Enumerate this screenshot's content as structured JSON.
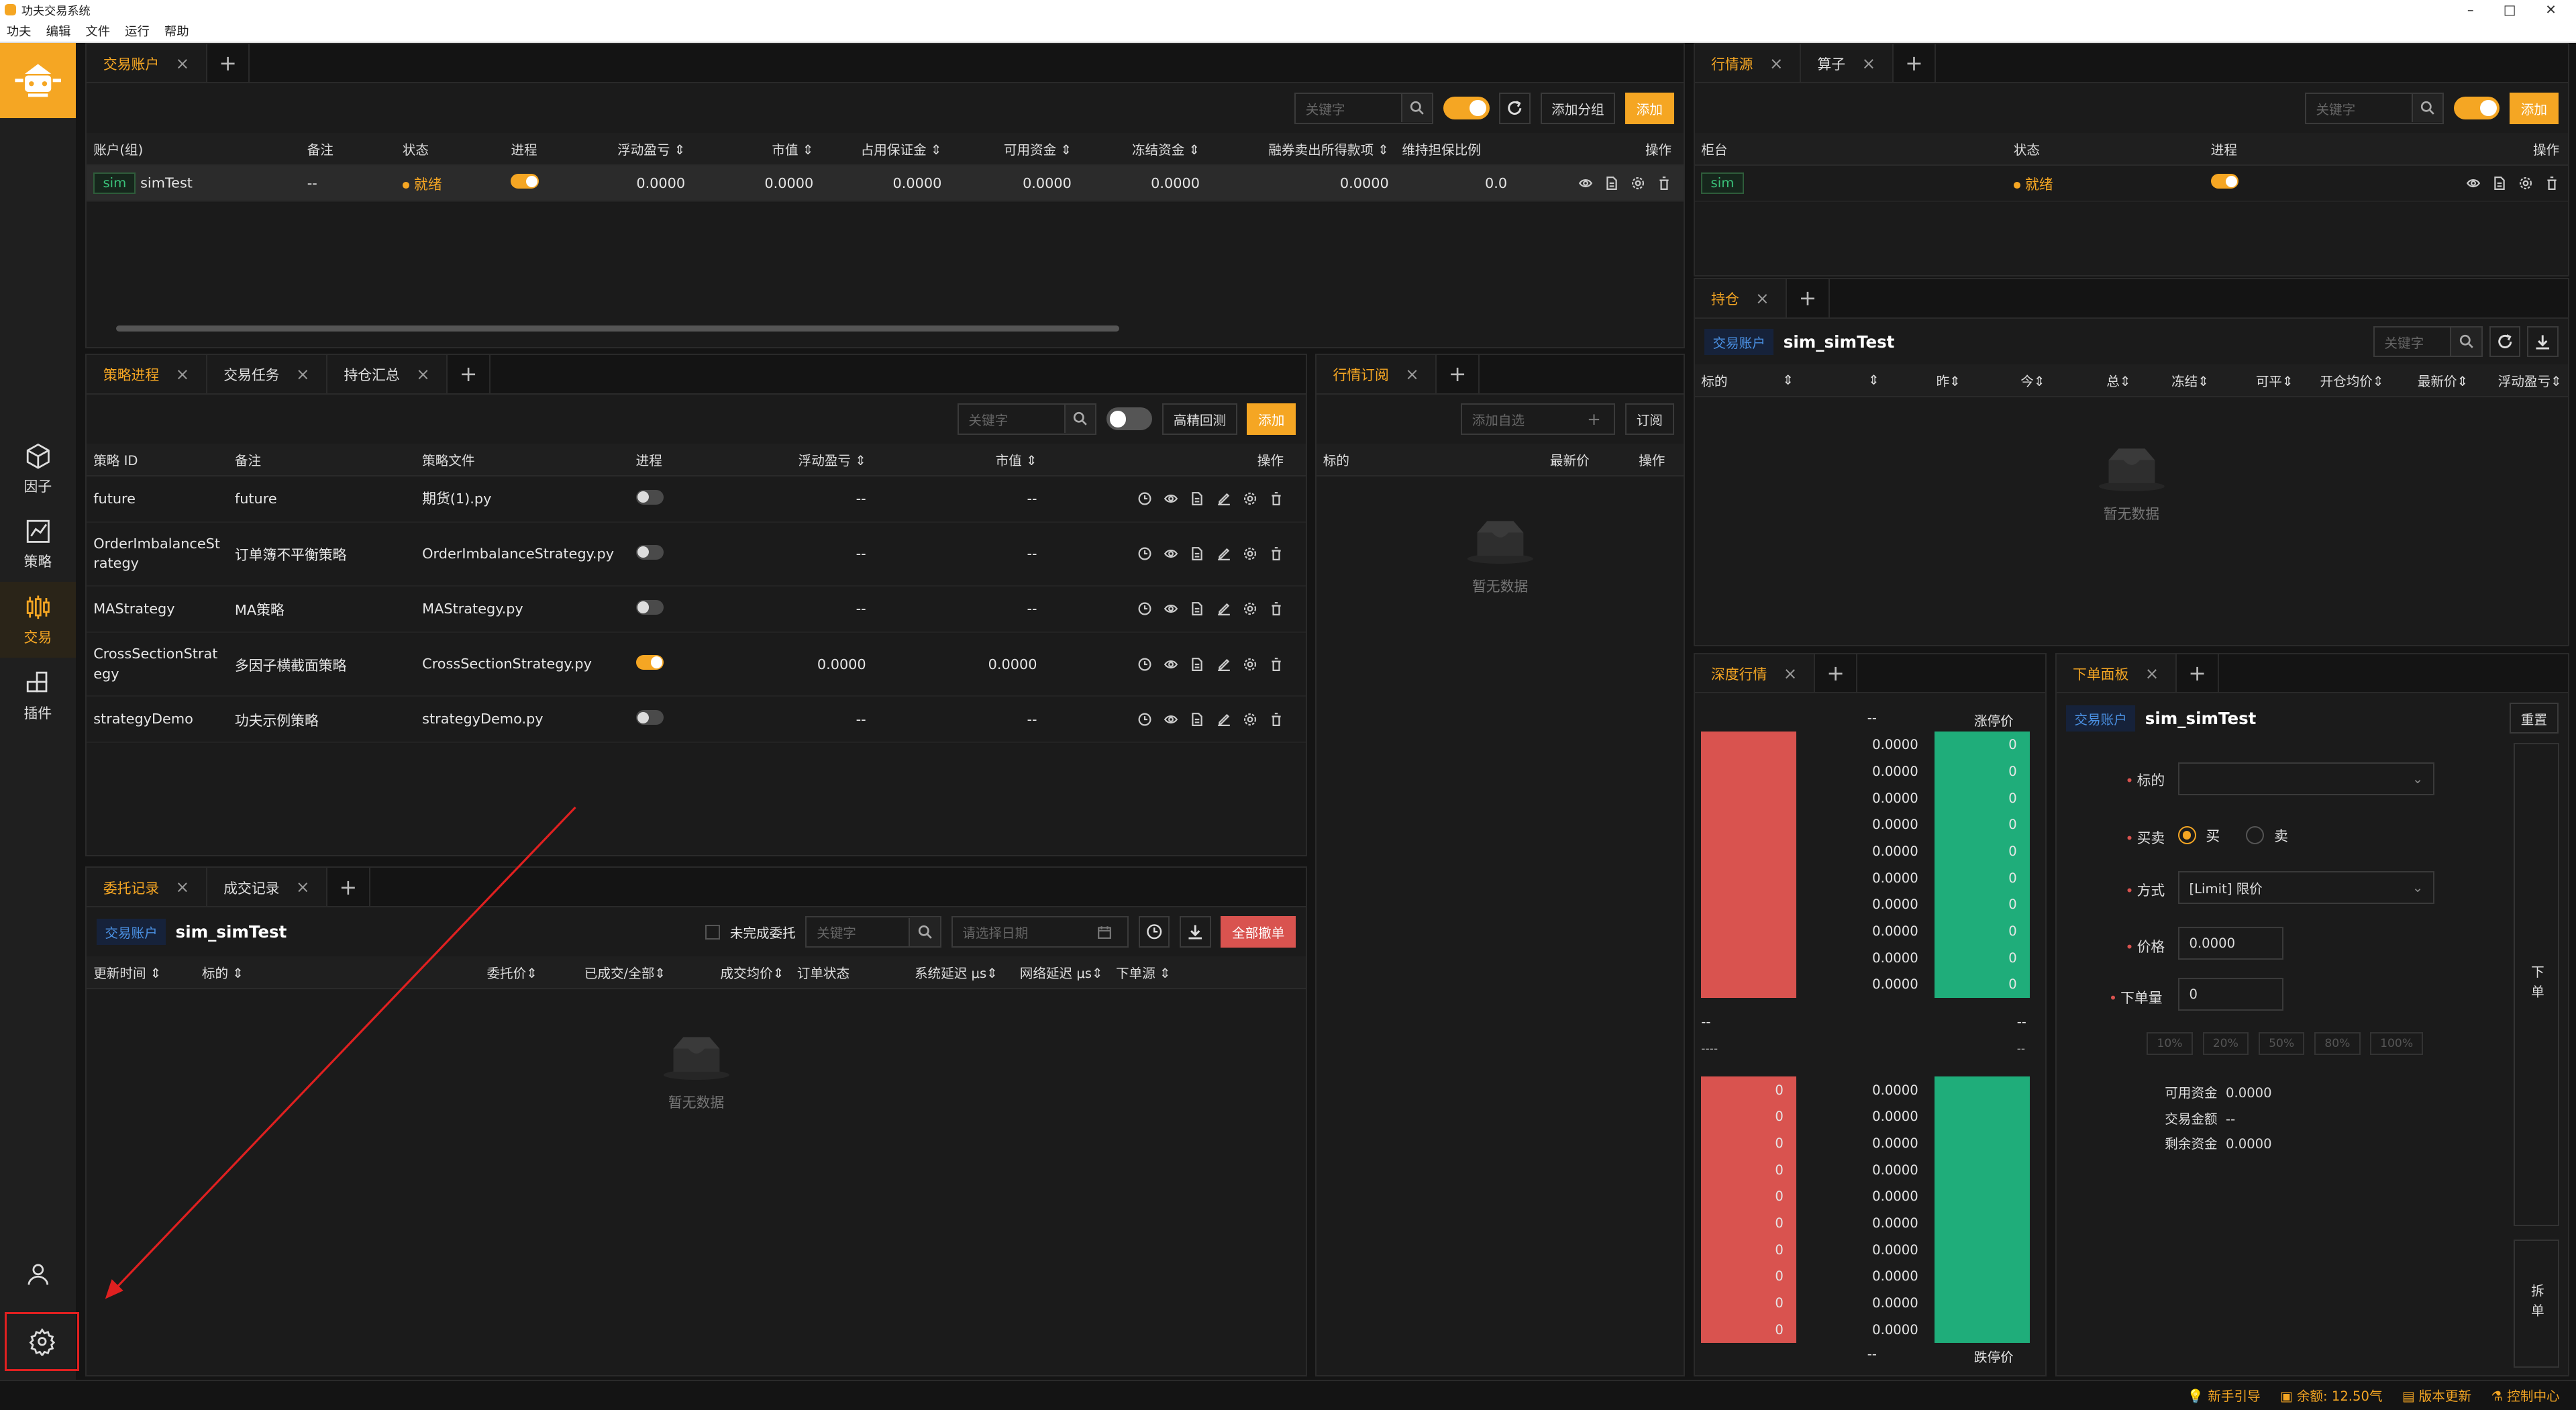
{
  "app": {
    "title": "功夫交易系统"
  },
  "menu": [
    "功夫",
    "编辑",
    "文件",
    "运行",
    "帮助"
  ],
  "window_controls": [
    "–",
    "□",
    "✕"
  ],
  "sidebar": {
    "items": [
      {
        "label": "因子",
        "icon": "cube-icon"
      },
      {
        "label": "策略",
        "icon": "chart-line-icon"
      },
      {
        "label": "交易",
        "icon": "trade-icon"
      },
      {
        "label": "插件",
        "icon": "plugin-icon"
      }
    ],
    "active": "交易"
  },
  "accounts_panel": {
    "tabs": [
      "交易账户"
    ],
    "search_placeholder": "关键字",
    "toggle_on": true,
    "add_group": "添加分组",
    "add": "添加",
    "columns": [
      "账户(组)",
      "备注",
      "状态",
      "进程",
      "浮动盈亏",
      "市值",
      "占用保证金",
      "可用资金",
      "冻结资金",
      "融券卖出所得款项",
      "维持担保比例",
      "操作"
    ],
    "rows": [
      {
        "tag": "sim",
        "account": "simTest",
        "note": "--",
        "status": "就绪",
        "process_on": true,
        "float_pnl": "0.0000",
        "market_value": "0.0000",
        "margin": "0.0000",
        "available": "0.0000",
        "frozen": "0.0000",
        "short_proceeds": "0.0000",
        "maintenance": "0.0"
      }
    ]
  },
  "market_source_panel": {
    "tabs": [
      "行情源",
      "算子"
    ],
    "search_placeholder": "关键字",
    "add": "添加",
    "columns": [
      "柜台",
      "状态",
      "进程",
      "操作"
    ],
    "rows": [
      {
        "tag": "sim",
        "status": "就绪",
        "process_on": true
      }
    ]
  },
  "positions_panel": {
    "tabs": [
      "持仓"
    ],
    "account_tag": "交易账户",
    "account_name": "sim_simTest",
    "search_placeholder": "关键字",
    "columns": [
      "标的",
      "",
      "昨",
      "今",
      "总",
      "冻结",
      "可平",
      "开仓均价",
      "最新价",
      "浮动盈亏"
    ],
    "empty": "暂无数据"
  },
  "strategy_panel": {
    "tabs": [
      "策略进程",
      "交易任务",
      "持仓汇总"
    ],
    "search_placeholder": "关键字",
    "backtest": "高精回测",
    "add": "添加",
    "columns": [
      "策略 ID",
      "备注",
      "策略文件",
      "进程",
      "浮动盈亏",
      "市值",
      "操作"
    ],
    "rows": [
      {
        "id": "future",
        "note": "future",
        "file": "期货(1).py",
        "on": false,
        "pnl": "--",
        "mv": "--"
      },
      {
        "id": "OrderImbalanceStrategy",
        "note": "订单簿不平衡策略",
        "file": "OrderImbalanceStrategy.py",
        "on": false,
        "pnl": "--",
        "mv": "--"
      },
      {
        "id": "MAStrategy",
        "note": "MA策略",
        "file": "MAStrategy.py",
        "on": false,
        "pnl": "--",
        "mv": "--"
      },
      {
        "id": "CrossSectionStrategy",
        "note": "多因子横截面策略",
        "file": "CrossSectionStrategy.py",
        "on": true,
        "pnl": "0.0000",
        "mv": "0.0000"
      },
      {
        "id": "strategyDemo",
        "note": "功夫示例策略",
        "file": "strategyDemo.py",
        "on": false,
        "pnl": "--",
        "mv": "--"
      }
    ]
  },
  "subscribe_panel": {
    "tabs": [
      "行情订阅"
    ],
    "add_placeholder": "添加自选",
    "subscribe": "订阅",
    "columns": [
      "标的",
      "最新价",
      "操作"
    ],
    "empty": "暂无数据"
  },
  "orders_panel": {
    "tabs": [
      "委托记录",
      "成交记录"
    ],
    "account_tag": "交易账户",
    "account_name": "sim_simTest",
    "unfinished": "未完成委托",
    "search_placeholder": "关键字",
    "date_placeholder": "请选择日期",
    "cancel_all": "全部撤单",
    "columns": [
      "更新时间",
      "标的",
      "",
      "委托价",
      "已成交/全部",
      "成交均价",
      "订单状态",
      "系统延迟 μs",
      "网络延迟 μs",
      "下单源"
    ],
    "empty": "暂无数据"
  },
  "depth_panel": {
    "tabs": [
      "深度行情"
    ],
    "top_dash": "--",
    "upper_limit": "涨停价",
    "lower_limit": "跌停价",
    "mid_left": "--",
    "mid_right": "--",
    "mid_left2": "----",
    "mid_right2": "--",
    "bottom_dash": "--",
    "ask_prices": [
      "0.0000",
      "0.0000",
      "0.0000",
      "0.0000",
      "0.0000",
      "0.0000",
      "0.0000",
      "0.0000",
      "0.0000",
      "0.0000"
    ],
    "ask_vols": [
      "0",
      "0",
      "0",
      "0",
      "0",
      "0",
      "0",
      "0",
      "0",
      "0"
    ],
    "bid_vols": [
      "0",
      "0",
      "0",
      "0",
      "0",
      "0",
      "0",
      "0",
      "0",
      "0"
    ],
    "bid_prices": [
      "0.0000",
      "0.0000",
      "0.0000",
      "0.0000",
      "0.0000",
      "0.0000",
      "0.0000",
      "0.0000",
      "0.0000",
      "0.0000"
    ]
  },
  "order_panel": {
    "tabs": [
      "下单面板"
    ],
    "account_tag": "交易账户",
    "account_name": "sim_simTest",
    "reset": "重置",
    "label_symbol": "标的",
    "label_side": "买卖",
    "buy": "买",
    "sell": "卖",
    "label_type": "方式",
    "type_value": "[Limit] 限价",
    "label_price": "价格",
    "price_value": "0.0000",
    "label_volume": "下单量",
    "volume_value": "0",
    "percents": [
      "10%",
      "20%",
      "50%",
      "80%",
      "100%"
    ],
    "available_label": "可用资金",
    "available_value": "0.0000",
    "amount_label": "交易金额",
    "amount_value": "--",
    "remaining_label": "剩余资金",
    "remaining_value": "0.0000",
    "submit": "下单",
    "split": "拆单"
  },
  "statusbar": {
    "guide": "新手引导",
    "balance": "余额: 12.50气",
    "update": "版本更新",
    "control": "控制中心"
  },
  "colors": {
    "accent": "#f5a623",
    "ask": "#d9534f",
    "bid": "#1fad7a",
    "annotation": "#e02020"
  }
}
